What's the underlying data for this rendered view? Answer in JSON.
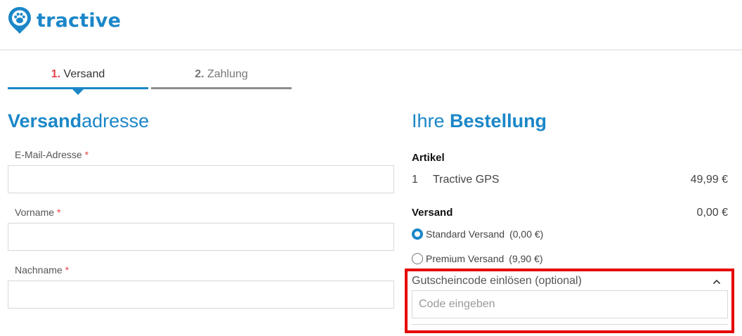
{
  "brand": {
    "name": "tractive",
    "color": "#1b87c8"
  },
  "steps": [
    {
      "num": "1.",
      "label": "Versand",
      "active": true
    },
    {
      "num": "2.",
      "label": "Zahlung",
      "active": false
    }
  ],
  "address": {
    "heading_bold": "Versand",
    "heading_rest": "adresse",
    "fields": [
      {
        "label": "E-Mail-Adresse",
        "required": "*",
        "value": ""
      },
      {
        "label": "Vorname",
        "required": "*",
        "value": ""
      },
      {
        "label": "Nachname",
        "required": "*",
        "value": ""
      }
    ]
  },
  "order": {
    "heading_rest": "Ihre ",
    "heading_bold": "Bestellung",
    "items_title": "Artikel",
    "items": [
      {
        "qty": "1",
        "name": "Tractive GPS",
        "price": "49,99 €"
      }
    ],
    "shipping_title": "Versand",
    "shipping_price": "0,00 €",
    "shipping_options": [
      {
        "name": "Standard Versand",
        "price": "(0,00 €)",
        "selected": true
      },
      {
        "name": "Premium Versand",
        "price": "(9,90 €)",
        "selected": false
      }
    ],
    "coupon": {
      "label": "Gutscheincode einlösen (optional)",
      "placeholder": "Code eingeben",
      "value": "",
      "toggle_icon": "chevron-up-icon"
    }
  },
  "colors": {
    "accent": "#1b87c8",
    "required": "#e8434a",
    "highlight": "#e60000"
  }
}
